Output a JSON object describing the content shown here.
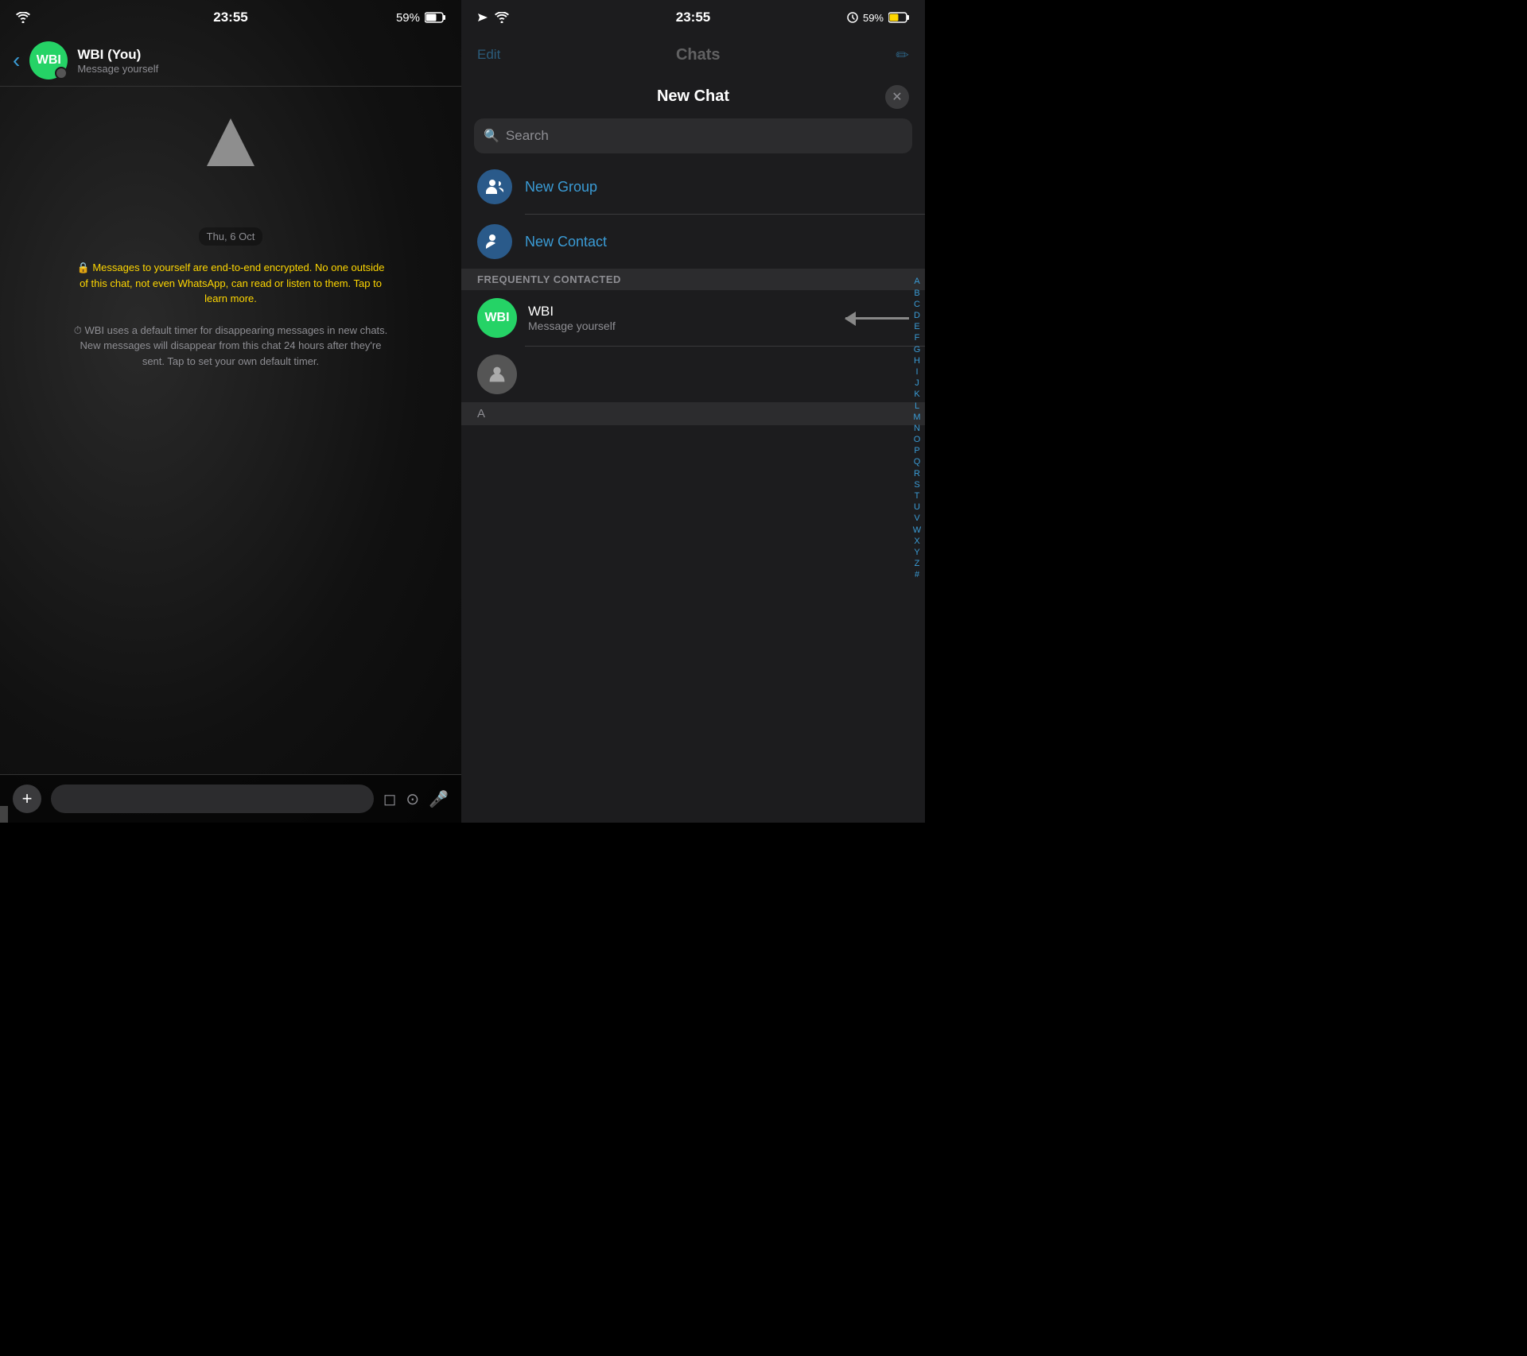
{
  "left": {
    "status_bar": {
      "time": "23:55",
      "battery": "59%"
    },
    "header": {
      "back_label": "‹",
      "avatar_text": "WBI",
      "name": "WBI (You)",
      "subtitle": "Message yourself"
    },
    "date_label": "Thu, 6 Oct",
    "system_msg1": "🔒 Messages to yourself are end-to-end encrypted. No one outside of this chat, not even WhatsApp, can read or listen to them. Tap to learn more.",
    "system_msg2": "⏱ WBI uses a default timer for disappearing messages in new chats. New messages will disappear from this chat 24 hours after they're sent. Tap to set your own default timer.",
    "input_placeholder": ""
  },
  "right": {
    "status_bar": {
      "time": "23:55",
      "battery": "59%"
    },
    "behind": {
      "edit_label": "Edit",
      "chats_label": "Chats",
      "compose_icon": "✏️"
    },
    "modal": {
      "title": "New Chat",
      "close_icon": "✕",
      "search_placeholder": "Search",
      "new_group_label": "New Group",
      "new_contact_label": "New Contact",
      "section_label": "FREQUENTLY CONTACTED",
      "contacts": [
        {
          "avatar_text": "WBI",
          "name": "WBI",
          "subtitle": "Message yourself",
          "has_arrow": true
        },
        {
          "avatar_text": "",
          "name": "",
          "subtitle": "",
          "has_arrow": false
        }
      ],
      "section_a": "A",
      "alphabet": [
        "A",
        "B",
        "C",
        "D",
        "E",
        "F",
        "G",
        "H",
        "I",
        "J",
        "K",
        "L",
        "M",
        "N",
        "O",
        "P",
        "Q",
        "R",
        "S",
        "T",
        "U",
        "V",
        "W",
        "X",
        "Y",
        "Z",
        "#"
      ]
    }
  }
}
